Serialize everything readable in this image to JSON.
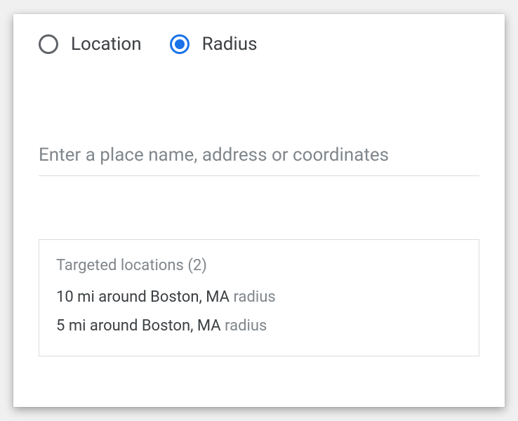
{
  "radio": {
    "options": [
      {
        "label": "Location",
        "selected": false
      },
      {
        "label": "Radius",
        "selected": true
      }
    ]
  },
  "search": {
    "placeholder": "Enter a place name, address or coordinates",
    "value": ""
  },
  "targeted": {
    "header_prefix": "Targeted locations",
    "count": 2,
    "items": [
      {
        "main": "10 mi around Boston, MA",
        "suffix": "radius"
      },
      {
        "main": "5 mi around Boston, MA",
        "suffix": "radius"
      }
    ]
  }
}
